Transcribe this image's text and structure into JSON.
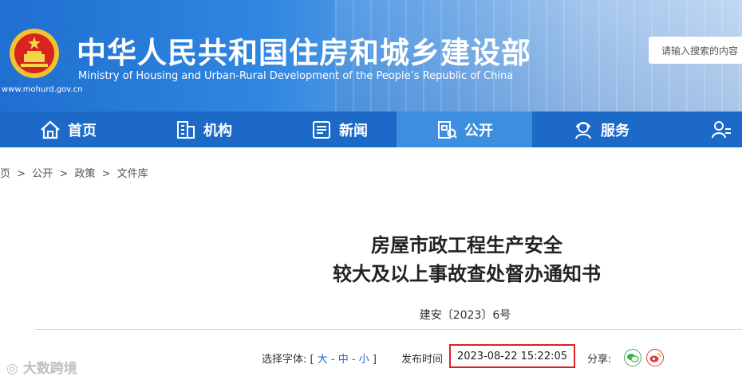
{
  "header": {
    "title_cn": "中华人民共和国住房和城乡建设部",
    "title_en": "Ministry of Housing and Urban-Rural Development of the People’s Republic of China",
    "site_url": "www.mohurd.gov.cn",
    "search_placeholder": "请输入搜索的内容"
  },
  "nav": {
    "items": [
      {
        "label": "首页",
        "icon": "home-icon"
      },
      {
        "label": "机构",
        "icon": "building-icon"
      },
      {
        "label": "新闻",
        "icon": "news-icon"
      },
      {
        "label": "公开",
        "icon": "open-doc-icon"
      },
      {
        "label": "服务",
        "icon": "service-icon"
      },
      {
        "label": "",
        "icon": "user-interact-icon"
      }
    ],
    "active": "公开"
  },
  "breadcrumb": {
    "items": [
      "页",
      "公开",
      "政策",
      "文件库"
    ],
    "sep": ">"
  },
  "article": {
    "title_line1": "房屋市政工程生产安全",
    "title_line2": "较大及以上事故查处督办通知书",
    "doc_number": "建安〔2023〕6号",
    "font_label": "选择字体:",
    "font_open": "[",
    "font_large": "大",
    "font_medium": "中",
    "font_small": "小",
    "font_dash": "-",
    "font_close": "]",
    "publish_label": "发布时间",
    "publish_time": "2023-08-22 15:22:05",
    "share_label": "分享:"
  },
  "watermark": "大数跨境",
  "colors": {
    "nav_bg": "#1d69c8",
    "nav_active": "#3e8ee0",
    "highlight_box": "#e02020"
  }
}
